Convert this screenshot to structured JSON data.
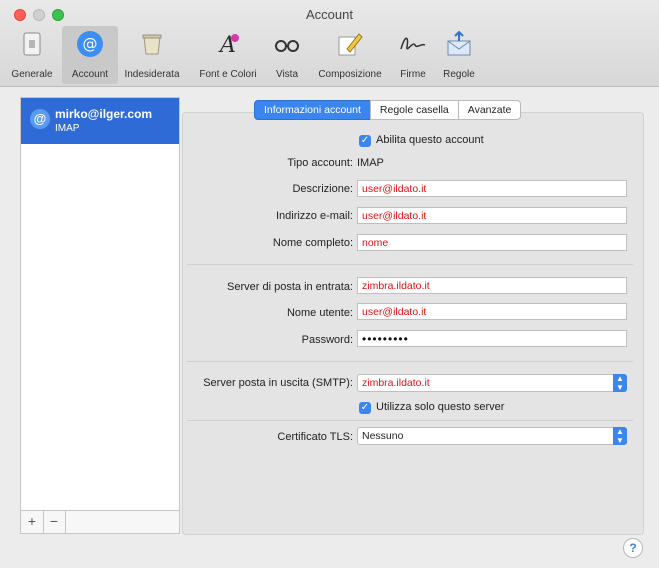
{
  "window": {
    "title": "Account"
  },
  "toolbar": {
    "items": [
      {
        "label": "Generale",
        "icon": "general-switch-icon"
      },
      {
        "label": "Account",
        "icon": "at-sign-icon"
      },
      {
        "label": "Indesiderata",
        "icon": "junk-trash-icon"
      },
      {
        "label": "Font e Colori",
        "icon": "font-colors-icon"
      },
      {
        "label": "Vista",
        "icon": "glasses-icon"
      },
      {
        "label": "Composizione",
        "icon": "pencil-compose-icon"
      },
      {
        "label": "Firme",
        "icon": "signature-icon"
      },
      {
        "label": "Regole",
        "icon": "rules-envelope-icon"
      }
    ],
    "selected": "Account"
  },
  "sidebar": {
    "account_name": "mirko@ilger.com",
    "account_type": "IMAP",
    "add_label": "+",
    "remove_label": "−"
  },
  "tabs": [
    {
      "label": "Informazioni account",
      "active": true
    },
    {
      "label": "Regole casella",
      "active": false
    },
    {
      "label": "Avanzate",
      "active": false
    }
  ],
  "form": {
    "enable_label": "Abilita questo account",
    "enable_checked": true,
    "type_label": "Tipo account:",
    "type_value": "IMAP",
    "description_label": "Descrizione:",
    "description_value": "user@ildato.it",
    "email_label": "Indirizzo e-mail:",
    "email_value": "user@ildato.it",
    "fullname_label": "Nome completo:",
    "fullname_value": "nome",
    "incoming_label": "Server di posta in entrata:",
    "incoming_value": "zimbra.ildato.it",
    "username_label": "Nome utente:",
    "username_value": "user@ildato.it",
    "password_label": "Password:",
    "password_value": "•••••••••",
    "smtp_label": "Server posta in uscita (SMTP):",
    "smtp_value": "zimbra.ildato.it",
    "only_server_label": "Utilizza solo questo server",
    "only_server_checked": true,
    "tls_label": "Certificato TLS:",
    "tls_value": "Nessuno"
  },
  "help": {
    "label": "?"
  },
  "colors": {
    "accent": "#3b86ee",
    "selection": "#2f6bd6",
    "field_text": "#e01010"
  }
}
